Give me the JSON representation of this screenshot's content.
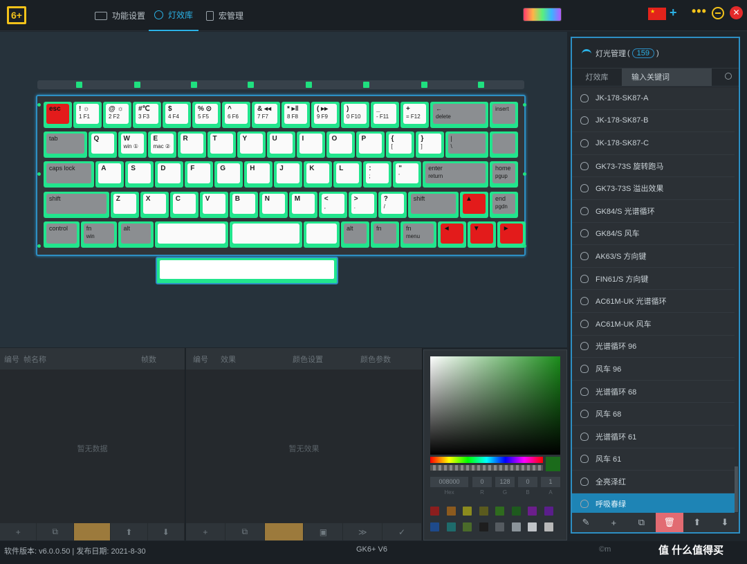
{
  "titlebar": {
    "tabs": [
      {
        "label": "功能设置"
      },
      {
        "label": "灯效库"
      },
      {
        "label": "宏管理"
      }
    ],
    "accent": "#2bb2e6"
  },
  "logo_text": "6+",
  "keyboard": {
    "keys": [
      {
        "main": "esc",
        "sub": "",
        "state": "red"
      },
      {
        "main": "! ☼",
        "sub": "1 F1",
        "state": "on"
      },
      {
        "main": "@ ☼",
        "sub": "2 F2",
        "state": "on"
      },
      {
        "main": "#℃",
        "sub": "3 F3",
        "state": "on"
      },
      {
        "main": "$",
        "sub": "4 F4",
        "state": "on"
      },
      {
        "main": "% ⊙",
        "sub": "5 F5",
        "state": "on"
      },
      {
        "main": "^",
        "sub": "6 F6",
        "state": "on"
      },
      {
        "main": "& ◂◂",
        "sub": "7 F7",
        "state": "on"
      },
      {
        "main": "* ▸‖",
        "sub": "8 F8",
        "state": "on"
      },
      {
        "main": "( ▸▸",
        "sub": "9 F9",
        "state": "on"
      },
      {
        "main": ")",
        "sub": "0 F10",
        "state": "on"
      },
      {
        "main": "_",
        "sub": "- F11",
        "state": "on"
      },
      {
        "main": "+",
        "sub": "= F12",
        "state": "on"
      },
      {
        "main": "←",
        "sub": "delete",
        "state": "gray"
      },
      {
        "main": "",
        "sub": "insert",
        "state": "gray"
      },
      {
        "main": "tab",
        "sub": "",
        "state": "gray"
      },
      {
        "main": "Q",
        "sub": "",
        "state": "on"
      },
      {
        "main": "W",
        "sub": "win ①",
        "state": "on"
      },
      {
        "main": "E",
        "sub": "mac ②",
        "state": "on"
      },
      {
        "main": "R",
        "sub": "",
        "state": "on"
      },
      {
        "main": "T",
        "sub": "",
        "state": "on"
      },
      {
        "main": "Y",
        "sub": "",
        "state": "on"
      },
      {
        "main": "U",
        "sub": "",
        "state": "on"
      },
      {
        "main": "I",
        "sub": "",
        "state": "on"
      },
      {
        "main": "O",
        "sub": "",
        "state": "on"
      },
      {
        "main": "P",
        "sub": "",
        "state": "on"
      },
      {
        "main": "{",
        "sub": "[",
        "state": "on"
      },
      {
        "main": "}",
        "sub": "]",
        "state": "on"
      },
      {
        "main": "|",
        "sub": "\\",
        "state": "gray"
      },
      {
        "main": "",
        "sub": "",
        "state": "gray"
      },
      {
        "main": "caps lock",
        "sub": "",
        "state": "gray"
      },
      {
        "main": "A",
        "sub": "",
        "state": "on"
      },
      {
        "main": "S",
        "sub": "",
        "state": "on"
      },
      {
        "main": "D",
        "sub": "",
        "state": "on"
      },
      {
        "main": "F",
        "sub": "",
        "state": "on"
      },
      {
        "main": "G",
        "sub": "",
        "state": "on"
      },
      {
        "main": "H",
        "sub": "",
        "state": "on"
      },
      {
        "main": "J",
        "sub": "",
        "state": "on"
      },
      {
        "main": "K",
        "sub": "",
        "state": "on"
      },
      {
        "main": "L",
        "sub": "",
        "state": "on"
      },
      {
        "main": ":",
        "sub": ";",
        "state": "on"
      },
      {
        "main": "\"",
        "sub": "'",
        "state": "on"
      },
      {
        "main": "enter",
        "sub": "return",
        "state": "gray"
      },
      {
        "main": "home",
        "sub": "pgup",
        "state": "gray"
      },
      {
        "main": "shift",
        "sub": "",
        "state": "gray"
      },
      {
        "main": "Z",
        "sub": "",
        "state": "on"
      },
      {
        "main": "X",
        "sub": "",
        "state": "on"
      },
      {
        "main": "C",
        "sub": "",
        "state": "on"
      },
      {
        "main": "V",
        "sub": "",
        "state": "on"
      },
      {
        "main": "B",
        "sub": "",
        "state": "on"
      },
      {
        "main": "N",
        "sub": "",
        "state": "on"
      },
      {
        "main": "M",
        "sub": "",
        "state": "on"
      },
      {
        "main": "<",
        "sub": ",",
        "state": "on"
      },
      {
        "main": ">",
        "sub": ".",
        "state": "on"
      },
      {
        "main": "?",
        "sub": "/",
        "state": "on"
      },
      {
        "main": "shift",
        "sub": "",
        "state": "gray"
      },
      {
        "main": "▲",
        "sub": "",
        "state": "red"
      },
      {
        "main": "end",
        "sub": "pgdn",
        "state": "gray"
      },
      {
        "main": "control",
        "sub": "",
        "state": "gray"
      },
      {
        "main": "fn",
        "sub": "win",
        "state": "gray"
      },
      {
        "main": "alt",
        "sub": "",
        "state": "gray"
      },
      {
        "main": "",
        "sub": "",
        "state": "on"
      },
      {
        "main": "",
        "sub": "",
        "state": "on"
      },
      {
        "main": "",
        "sub": "",
        "state": "on"
      },
      {
        "main": "alt",
        "sub": "",
        "state": "gray"
      },
      {
        "main": "fn",
        "sub": "",
        "state": "gray"
      },
      {
        "main": "fn",
        "sub": "menu",
        "state": "gray"
      },
      {
        "main": "◄",
        "sub": "",
        "state": "red"
      },
      {
        "main": "▼",
        "sub": "",
        "state": "red"
      },
      {
        "main": "►",
        "sub": "",
        "state": "red"
      }
    ],
    "on_color": "#22e58d",
    "red_color": "#e31b1b"
  },
  "panel_left": {
    "headers": [
      "编号",
      "帧名称",
      "帧数"
    ],
    "empty": "暂无数据",
    "buttons": [
      "+",
      "⧉",
      "",
      "⬆",
      "⬇"
    ]
  },
  "panel_mid": {
    "headers": [
      "编号",
      "效果",
      "颜色设置",
      "颜色参数"
    ],
    "empty": "暂无效果",
    "buttons": [
      "+",
      "⧉",
      "",
      "▣",
      "≫",
      "✓"
    ]
  },
  "color_picker": {
    "hex": "008000",
    "r": "0",
    "g": "128",
    "b": "0",
    "a": "1",
    "labels": [
      "Hex",
      "R",
      "G",
      "B",
      "A"
    ],
    "swatches": [
      "#8b1e1e",
      "#8b5a1e",
      "#8b8b1e",
      "#5a5a1e",
      "#2f6b1e",
      "#1e5a1e",
      "#6b1e8b",
      "#5a1e8b",
      "#1e4a8b",
      "#1e6b6b",
      "#4a6b2a",
      "#1e1e1e",
      "#555b60",
      "#8b949a",
      "#c0c4c8",
      "#b8b8b8"
    ]
  },
  "effect_list": {
    "title": "灯光管理",
    "count": "159",
    "tab_label": "灯效库",
    "search_placeholder": "输入关键词",
    "items": [
      "JK-178-SK87-A",
      "JK-178-SK87-B",
      "JK-178-SK87-C",
      "GK73-73S 旋转跑马",
      "GK73-73S 溢出效果",
      "GK84/S 光谱循环",
      "GK84/S 风车",
      "AK63/S 方向键",
      "FIN61/S 方向键",
      "AC61M-UK 光谱循环",
      "AC61M-UK 风车",
      "光谱循环 96",
      "风车 96",
      "光谱循环 68",
      "风车 68",
      "光谱循环 61",
      "风车 61",
      "全亮泽红",
      "呼吸春绿"
    ],
    "selected_index": 18,
    "buttons": [
      "✎",
      "+",
      "⧉",
      "🗑",
      "⬆",
      "⬇"
    ]
  },
  "statusbar": {
    "version": "软件版本: v6.0.0.50 | 发布日期: 2021-8-30",
    "model": "GK6+ V6",
    "right": "©m",
    "watermark": "值 什么值得买"
  }
}
